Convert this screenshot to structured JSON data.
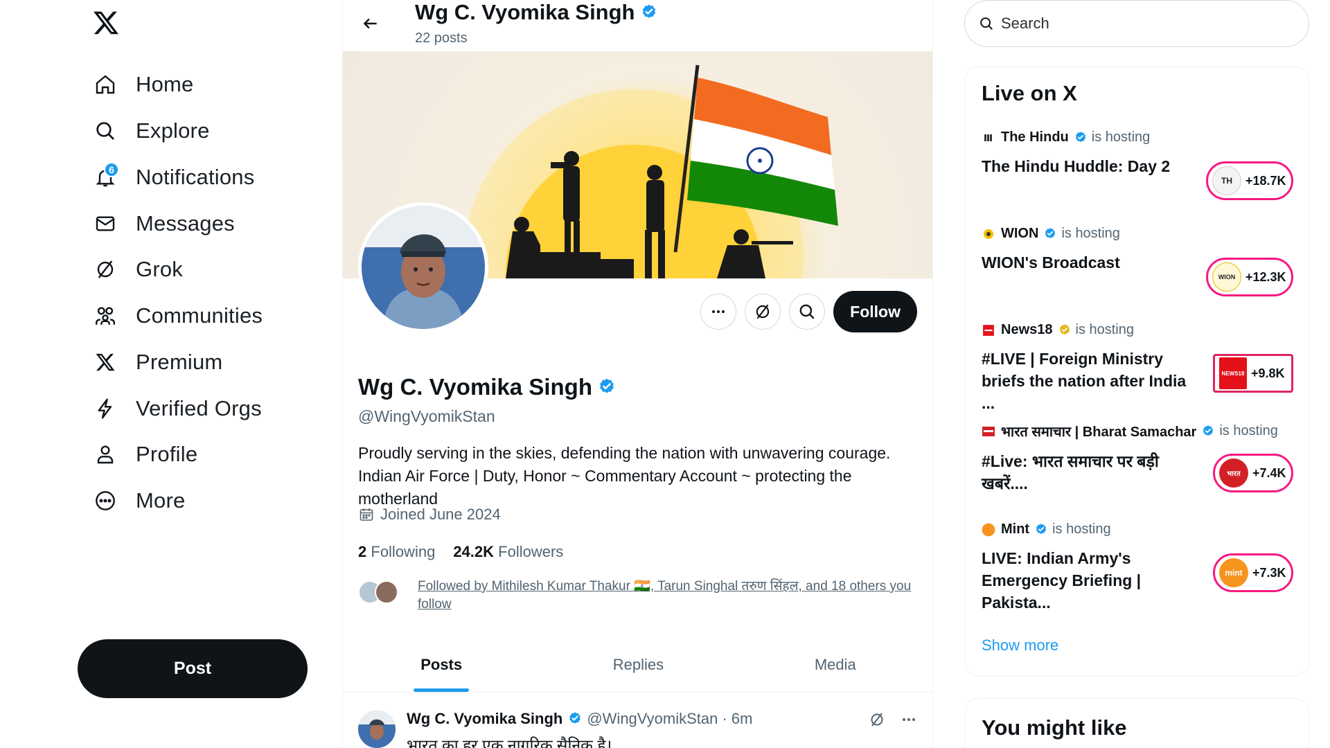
{
  "sidebar": {
    "items": [
      {
        "label": "Home",
        "icon": "home-icon"
      },
      {
        "label": "Explore",
        "icon": "search-icon"
      },
      {
        "label": "Notifications",
        "icon": "bell-icon",
        "badge": "6"
      },
      {
        "label": "Messages",
        "icon": "envelope-icon"
      },
      {
        "label": "Grok",
        "icon": "grok-icon"
      },
      {
        "label": "Communities",
        "icon": "people-icon"
      },
      {
        "label": "Premium",
        "icon": "x-logo-icon"
      },
      {
        "label": "Verified Orgs",
        "icon": "lightning-icon"
      },
      {
        "label": "Profile",
        "icon": "person-icon"
      },
      {
        "label": "More",
        "icon": "more-circle-icon"
      }
    ],
    "post_label": "Post"
  },
  "header": {
    "name": "Wg C. Vyomika Singh",
    "post_count": "22 posts"
  },
  "profile": {
    "name": "Wg C. Vyomika Singh",
    "handle": "@WingVyomikStan",
    "bio": "Proudly serving in the skies, defending the nation with unwavering courage. Indian Air Force | Duty, Honor ~ Commentary Account ~  protecting the motherland",
    "joined": "Joined June 2024",
    "following_count": "2",
    "following_label": "Following",
    "followers_count": "24.2K",
    "followers_label": "Followers",
    "followed_by": "Followed by Mithilesh Kumar Thakur 🇮🇳, Tarun Singhal तरुण सिंहल, and 18 others you follow",
    "follow_label": "Follow"
  },
  "tabs": [
    {
      "label": "Posts",
      "active": true
    },
    {
      "label": "Replies",
      "active": false
    },
    {
      "label": "Media",
      "active": false
    }
  ],
  "tweet": {
    "name": "Wg C. Vyomika Singh",
    "meta": "@WingVyomikStan · 6m",
    "text": "भारत का हर एक नागरिक सैनिक है।"
  },
  "search": {
    "placeholder": "Search"
  },
  "live": {
    "title": "Live on X",
    "hosting_label": "is hosting",
    "items": [
      {
        "host": "The Hindu",
        "title": "The Hindu Huddle: Day 2",
        "count": "+18.7K",
        "badge": "TH"
      },
      {
        "host": "WION",
        "title": "WION's Broadcast",
        "count": "+12.3K",
        "badge": "WION"
      },
      {
        "host": "News18",
        "title": "#LIVE | Foreign Ministry briefs the nation after India ...",
        "count": "+9.8K",
        "badge": "NEWS18"
      },
      {
        "host": "भारत समाचार | Bharat Samachar",
        "title": "#Live: भारत समाचार पर बड़ी खबरें....",
        "count": "+7.4K",
        "badge": "भारत"
      },
      {
        "host": "Mint",
        "title": "LIVE: Indian Army's Emergency Briefing | Pakista...",
        "count": "+7.3K",
        "badge": "mint"
      }
    ],
    "show_more": "Show more"
  },
  "you_might_like": {
    "title": "You might like"
  },
  "colors": {
    "accent": "#1d9bf0",
    "live_ring": "#f91880",
    "text": "#0f1419",
    "muted": "#536471"
  }
}
